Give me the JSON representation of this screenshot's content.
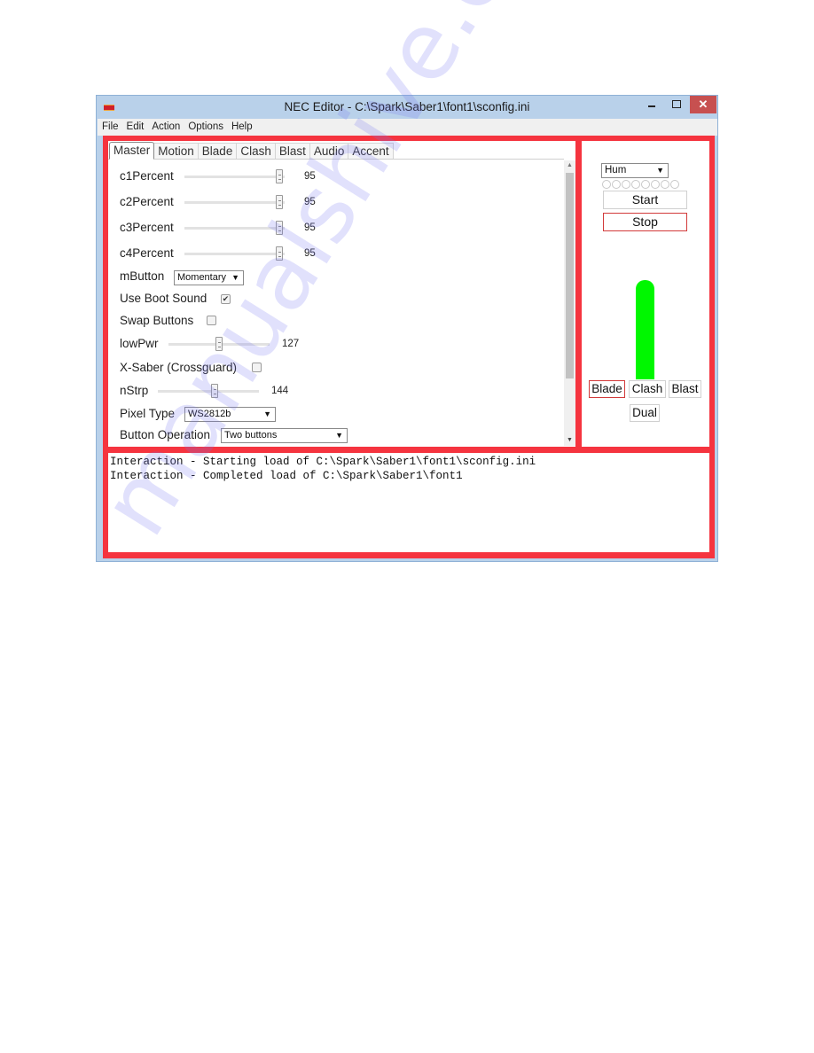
{
  "window": {
    "title": "NEC Editor - C:\\Spark\\Saber1\\font1\\sconfig.ini",
    "controls": {
      "minimize": "",
      "maximize": "",
      "close": "✕"
    }
  },
  "menu": [
    "File",
    "Edit",
    "Action",
    "Options",
    "Help"
  ],
  "tabs": [
    {
      "label": "Master",
      "active": true
    },
    {
      "label": "Motion"
    },
    {
      "label": "Blade"
    },
    {
      "label": "Clash"
    },
    {
      "label": "Blast"
    },
    {
      "label": "Audio"
    },
    {
      "label": "Accent"
    }
  ],
  "master": {
    "c1Percent": {
      "label": "c1Percent",
      "value": "95",
      "fraction": 0.95
    },
    "c2Percent": {
      "label": "c2Percent",
      "value": "95",
      "fraction": 0.95
    },
    "c3Percent": {
      "label": "c3Percent",
      "value": "95",
      "fraction": 0.95
    },
    "c4Percent": {
      "label": "c4Percent",
      "value": "95",
      "fraction": 0.95
    },
    "mButton": {
      "label": "mButton",
      "selected": "Momentary"
    },
    "useBootSound": {
      "label": "Use Boot Sound",
      "checked": true,
      "mark": "✔"
    },
    "swapButtons": {
      "label": "Swap Buttons",
      "checked": false
    },
    "lowPwr": {
      "label": "lowPwr",
      "value": "127",
      "fraction": 0.5
    },
    "xSaber": {
      "label": "X-Saber (Crossguard)",
      "checked": false
    },
    "nStrp": {
      "label": "nStrp",
      "value": "144",
      "fraction": 0.56
    },
    "pixelType": {
      "label": "Pixel Type",
      "selected": "WS2812b"
    },
    "buttonOperation": {
      "label": "Button Operation",
      "selected": "Two buttons"
    }
  },
  "scrollbar": {
    "up": "▲",
    "down": "▼"
  },
  "preview": {
    "sound_select": "Hum",
    "dot_count": 8,
    "start_label": "Start",
    "stop_label": "Stop",
    "blade_color": "#00f700",
    "buttons": [
      "Blade",
      "Clash",
      "Blast"
    ],
    "dual_label": "Dual"
  },
  "log": [
    "Interaction - Starting load of C:\\Spark\\Saber1\\font1\\sconfig.ini",
    "Interaction - Completed load of C:\\Spark\\Saber1\\font1"
  ],
  "dropdown_arrow": "▼",
  "watermark": "manualshive.com",
  "colors": {
    "frame": "#f5343f",
    "titlebar": "#b9d1ea",
    "close": "#c75050"
  }
}
